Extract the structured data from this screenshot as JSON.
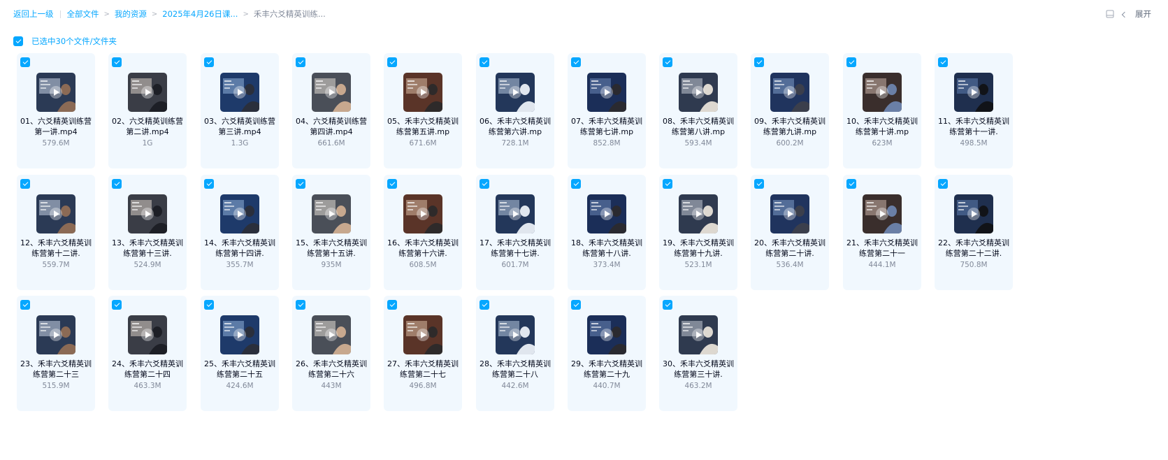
{
  "breadcrumb": {
    "back": "返回上一级",
    "items": [
      "全部文件",
      "我的资源",
      "2025年4月26日课...",
      "禾丰六爻精英训练..."
    ]
  },
  "toolbar": {
    "expand_label": "展开"
  },
  "selection": {
    "label": "已选中30个文件/文件夹"
  },
  "colors": {
    "accent": "#06a7ff",
    "card_bg": "#f1f8fe"
  },
  "files": [
    {
      "name": "01、六爻精英训练营第一讲.mp4",
      "size": "579.6M"
    },
    {
      "name": "02、六爻精英训练营第二讲.mp4",
      "size": "1G"
    },
    {
      "name": "03、六爻精英训练营第三讲.mp4",
      "size": "1.3G"
    },
    {
      "name": "04、六爻精英训练营第四讲.mp4",
      "size": "661.6M"
    },
    {
      "name": "05、禾丰六爻精英训练营第五讲.mp",
      "size": "671.6M"
    },
    {
      "name": "06、禾丰六爻精英训练营第六讲.mp",
      "size": "728.1M"
    },
    {
      "name": "07、禾丰六爻精英训练营第七讲.mp",
      "size": "852.8M"
    },
    {
      "name": "08、禾丰六爻精英训练营第八讲.mp",
      "size": "593.4M"
    },
    {
      "name": "09、禾丰六爻精英训练营第九讲.mp",
      "size": "600.2M"
    },
    {
      "name": "10、禾丰六爻精英训练营第十讲.mp",
      "size": "623M"
    },
    {
      "name": "11、禾丰六爻精英训练营第十一讲.",
      "size": "498.5M"
    },
    {
      "name": "12、禾丰六爻精英训练营第十二讲.",
      "size": "559.7M"
    },
    {
      "name": "13、禾丰六爻精英训练营第十三讲.",
      "size": "524.9M"
    },
    {
      "name": "14、禾丰六爻精英训练营第十四讲.",
      "size": "355.7M"
    },
    {
      "name": "15、禾丰六爻精英训练营第十五讲.",
      "size": "935M"
    },
    {
      "name": "16、禾丰六爻精英训练营第十六讲.",
      "size": "608.5M"
    },
    {
      "name": "17、禾丰六爻精英训练营第十七讲.",
      "size": "601.7M"
    },
    {
      "name": "18、禾丰六爻精英训练营第十八讲.",
      "size": "373.4M"
    },
    {
      "name": "19、禾丰六爻精英训练营第十九讲.",
      "size": "523.1M"
    },
    {
      "name": "20、禾丰六爻精英训练营第二十讲.",
      "size": "536.4M"
    },
    {
      "name": "21、禾丰六爻精英训练营第二十一",
      "size": "444.1M"
    },
    {
      "name": "22、禾丰六爻精英训练营第二十二讲.",
      "size": "750.8M"
    },
    {
      "name": "23、禾丰六爻精英训练营第二十三",
      "size": "515.9M"
    },
    {
      "name": "24、禾丰六爻精英训练营第二十四",
      "size": "463.3M"
    },
    {
      "name": "25、禾丰六爻精英训练营第二十五",
      "size": "424.6M"
    },
    {
      "name": "26、禾丰六爻精英训练营第二十六",
      "size": "443M"
    },
    {
      "name": "27、禾丰六爻精英训练营第二十七",
      "size": "496.8M"
    },
    {
      "name": "28、禾丰六爻精英训练营第二十八",
      "size": "442.6M"
    },
    {
      "name": "29、禾丰六爻精英训练营第二十九",
      "size": "440.7M"
    },
    {
      "name": "30、禾丰六爻精英训练营第三十讲.",
      "size": "463.2M"
    }
  ]
}
